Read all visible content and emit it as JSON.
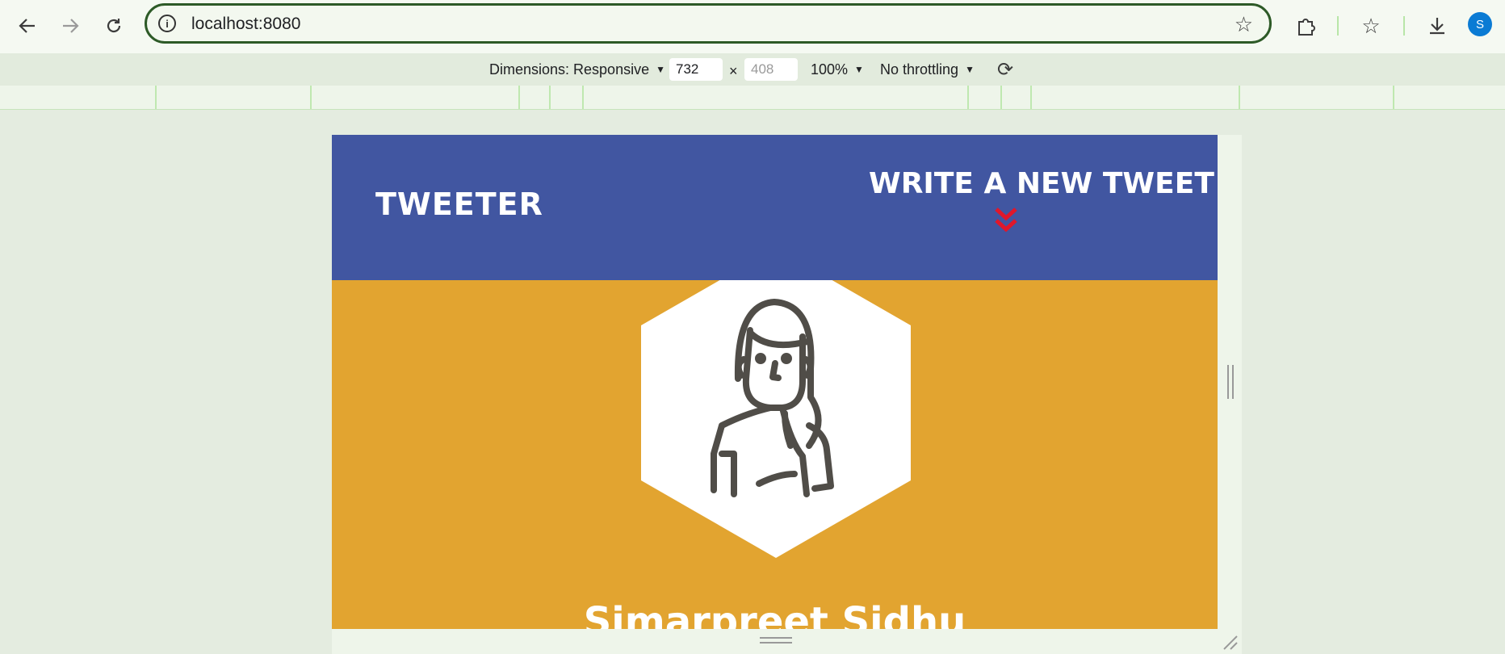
{
  "browser": {
    "url": "localhost:8080",
    "profile_initial": "S",
    "accent_color": "#2d5a27"
  },
  "devtools": {
    "dimensions_label": "Dimensions: Responsive",
    "width_value": "732",
    "height_placeholder": "408",
    "zoom": "100%",
    "throttling": "No throttling",
    "times_sign": "×"
  },
  "page": {
    "brand": "Tweeter",
    "compose_label": "Write a new tweet",
    "user_name": "Simarpreet Sidhu",
    "header_color": "#4156a1",
    "body_color": "#e2a430",
    "chevron_color": "#e0172b"
  },
  "icons": {
    "back": "arrow-left-icon",
    "forward": "arrow-right-icon",
    "reload": "reload-icon",
    "site_info": "info-icon",
    "bookmark": "star-icon",
    "extensions": "puzzle-icon",
    "favorites": "star-list-icon",
    "downloads": "download-icon",
    "rotate": "rotate-icon",
    "compose": "double-chevron-down-icon",
    "avatar": "user-avatar-icon"
  }
}
